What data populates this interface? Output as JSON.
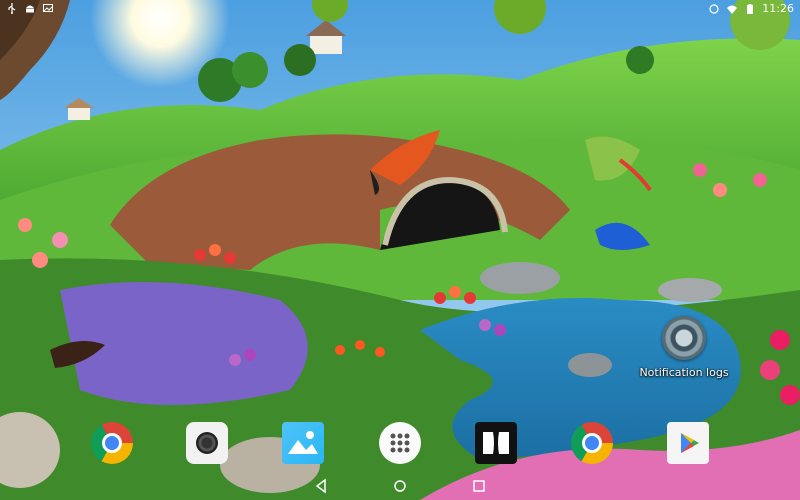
{
  "status_bar": {
    "time": "11:26",
    "left_icons": [
      "usb-icon",
      "android-icon",
      "image-icon"
    ],
    "right_icons": [
      "sync-icon",
      "wifi-icon",
      "battery-icon"
    ]
  },
  "desktop": {
    "shortcuts": [
      {
        "label": "Notification logs",
        "icon": "notification-logs-icon"
      }
    ]
  },
  "dock": {
    "apps": [
      {
        "name": "Chrome",
        "icon": "chrome-icon"
      },
      {
        "name": "Camera",
        "icon": "camera-icon"
      },
      {
        "name": "Gallery",
        "icon": "gallery-icon"
      },
      {
        "name": "All apps",
        "icon": "app-drawer-icon"
      },
      {
        "name": "Dolby",
        "icon": "dolby-icon"
      },
      {
        "name": "Chrome",
        "icon": "chrome-icon"
      },
      {
        "name": "Play Store",
        "icon": "play-store-icon"
      }
    ]
  },
  "nav_bar": {
    "buttons": [
      "back-icon",
      "home-icon",
      "recents-icon"
    ]
  }
}
